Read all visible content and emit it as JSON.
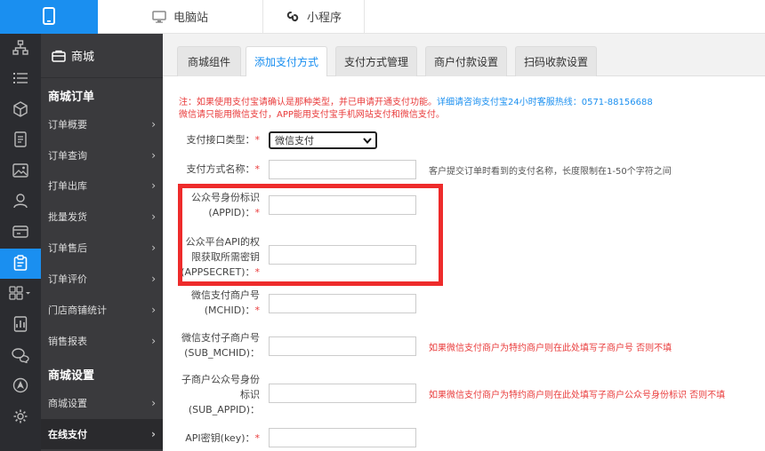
{
  "topbar": {
    "tabs": [
      {
        "label": "电脑站",
        "icon": "monitor-icon"
      },
      {
        "label": "小程序",
        "icon": "mini-program-icon"
      }
    ]
  },
  "menu": {
    "header": "商城",
    "sections": [
      {
        "title": "商城订单",
        "items": [
          "订单概要",
          "订单查询",
          "打单出库",
          "批量发货",
          "订单售后",
          "订单评价",
          "门店商铺统计",
          "销售报表"
        ]
      },
      {
        "title": "商城设置",
        "items": [
          "商城设置",
          "在线支付"
        ]
      }
    ],
    "active_item": "在线支付"
  },
  "tabs": [
    "商城组件",
    "添加支付方式",
    "支付方式管理",
    "商户付款设置",
    "扫码收款设置"
  ],
  "active_tab": "添加支付方式",
  "notice": {
    "line1_red": "注：如果使用支付宝请确认是那种类型，并已申请开通支付功能。",
    "line1_blue": "详细请咨询支付宝24小时客服热线：0571-88156688",
    "line2": "微信请只能用微信支付，APP能用支付宝手机网站支付和微信支付。"
  },
  "form": {
    "type_label": "支付接口类型：",
    "type_value": "微信支付",
    "name_label": "支付方式名称：",
    "name_hint": "客户提交订单时看到的支付名称，长度限制在1-50个字符之间",
    "appid_line1": "公众号身份标识",
    "appid_line2": "(APPID)：",
    "secret_line1": "公众平台API的权",
    "secret_line2": "限获取所需密钥",
    "secret_line3": "(APPSECRET)：",
    "mchid_line1": "微信支付商户号",
    "mchid_line2": "(MCHID)：",
    "sub_mchid_line1": "微信支付子商户号",
    "sub_mchid_line2": "(SUB_MCHID)：",
    "sub_mchid_hint": "如果微信支付商户为特约商户则在此处填写子商户号 否则不填",
    "sub_appid_line1": "子商户公众号身份",
    "sub_appid_line2": "标识",
    "sub_appid_line3": "(SUB_APPID)：",
    "sub_appid_hint": "如果微信支付商户为特约商户则在此处填写子商户公众号身份标识 否则不填",
    "key_label": "API密钥(key)：",
    "required_mark": "*"
  },
  "colors": {
    "accent": "#1a8ff0",
    "rail_bg": "#2b2c30",
    "menu_bg": "#3a3a3d",
    "required": "#e93b3b",
    "highlight": "#ee2b2b"
  }
}
